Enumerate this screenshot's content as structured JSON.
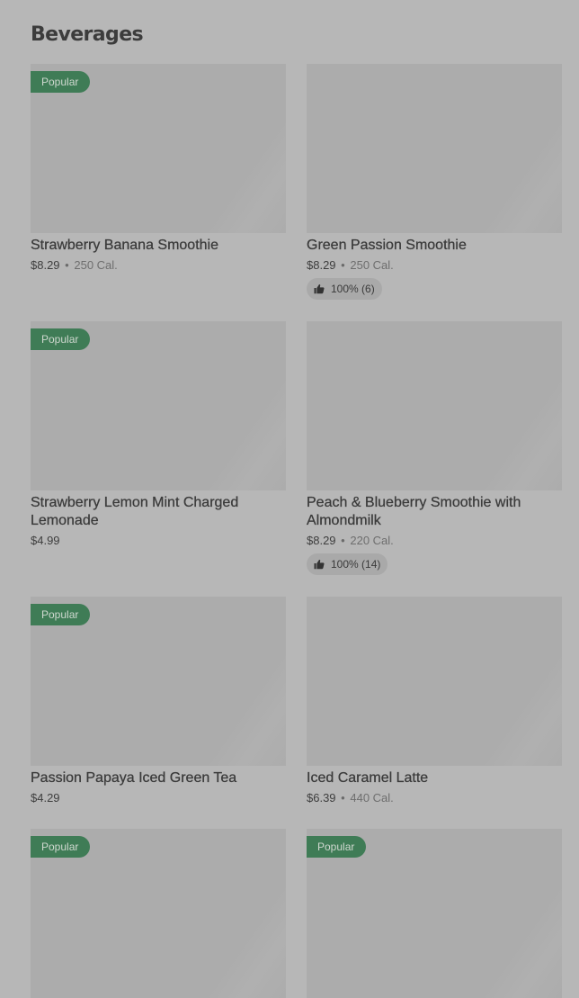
{
  "section": {
    "title": "Beverages"
  },
  "items": [
    {
      "badge": "Popular",
      "name": "Strawberry Banana Smoothie",
      "price": "$8.29",
      "dot": "•",
      "calories": "250 Cal."
    },
    {
      "name": "Green Passion Smoothie",
      "price": "$8.29",
      "dot": "•",
      "calories": "250 Cal.",
      "rating": "100% (6)",
      "rating_icon": "thumbs-up-icon"
    },
    {
      "badge": "Popular",
      "name": "Strawberry Lemon Mint Charged Lemonade",
      "price": "$4.99"
    },
    {
      "name": "Peach & Blueberry Smoothie with Almondmilk",
      "price": "$8.29",
      "dot": "•",
      "calories": "220 Cal.",
      "rating": "100% (14)",
      "rating_icon": "thumbs-up-icon"
    },
    {
      "badge": "Popular",
      "name": "Passion Papaya Iced Green Tea",
      "price": "$4.29"
    },
    {
      "name": "Iced Caramel Latte",
      "price": "$6.39",
      "dot": "•",
      "calories": "440 Cal."
    },
    {
      "badge": "Popular"
    },
    {
      "badge": "Popular"
    }
  ],
  "colors": {
    "overlay_background": "#b7b7b7",
    "badge_background": "#3f7c56",
    "image_placeholder": "#acacac"
  }
}
